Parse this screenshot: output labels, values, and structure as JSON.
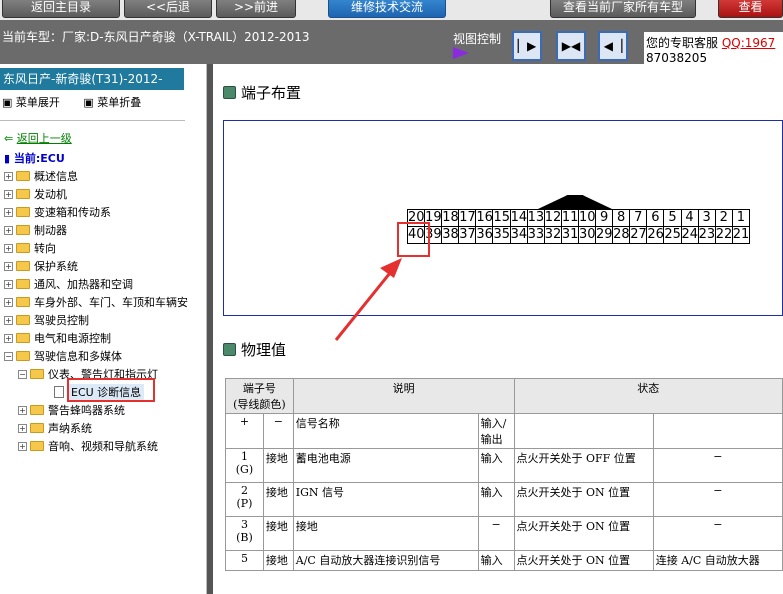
{
  "nav": {
    "home": "返回主目录",
    "back": "<<后退",
    "forward": ">>前进",
    "tech": "维修技术交流",
    "check": "查看当前厂家所有车型",
    "red": "查看"
  },
  "infobar": {
    "car_model": "当前车型：厂家:D-东风日产奇骏（X-TRAIL）2012-2013",
    "view_control": "视图控制",
    "cs_label": "您的专职客服",
    "qq": "QQ:1967",
    "qq_cont": "87038205"
  },
  "sidebar": {
    "title": "东风日产-新奇骏(T31)-2012-",
    "expand": "菜单展开",
    "collapse": "菜单折叠",
    "back_level": "返回上一级",
    "current": "当前:ECU",
    "items": [
      "概述信息",
      "发动机",
      "变速箱和传动系",
      "制动器",
      "转向",
      "保护系统",
      "通风、加热器和空调",
      "车身外部、车门、车顶和车辆安",
      "驾驶员控制",
      "电气和电源控制",
      "驾驶信息和多媒体",
      "仪表、警告灯和指示灯",
      "ECU 诊断信息",
      "警告蜂鸣器系统",
      "声纳系统",
      "音响、视频和导航系统"
    ]
  },
  "main": {
    "terminal_layout": "端子布置",
    "physical_values": "物理值",
    "top_pins": [
      "20",
      "19",
      "18",
      "17",
      "16",
      "15",
      "14",
      "13",
      "12",
      "11",
      "10",
      "9",
      "8",
      "7",
      "6",
      "5",
      "4",
      "3",
      "2",
      "1"
    ],
    "bottom_pins": [
      "40",
      "39",
      "38",
      "37",
      "36",
      "35",
      "34",
      "33",
      "32",
      "31",
      "30",
      "29",
      "28",
      "27",
      "26",
      "25",
      "24",
      "23",
      "22",
      "21"
    ],
    "table": {
      "h_terminal": "端子号",
      "h_wire": "(导线颜色)",
      "h_desc": "说明",
      "h_status": "状态",
      "h_plus": "+",
      "h_minus": "−",
      "h_signal": "信号名称",
      "h_io1": "输入/",
      "h_io2": "输出",
      "rows": [
        {
          "num": "1",
          "color": "(G)",
          "ground": "接地",
          "signal": "蓄电池电源",
          "io": "输入",
          "cond": "点火开关处于  OFF 位置",
          "state": "−"
        },
        {
          "num": "2",
          "color": "(P)",
          "ground": "接地",
          "signal": "IGN 信号",
          "io": "输入",
          "cond": "点火开关处于  ON 位置",
          "state": "−"
        },
        {
          "num": "3",
          "color": "(B)",
          "ground": "接地",
          "signal": "接地",
          "io": "−",
          "cond": "点火开关处于  ON 位置",
          "state": "−"
        },
        {
          "num": "5",
          "color": "",
          "ground": "接地",
          "signal": "A/C 自动放大器连接识别信号",
          "io": "输入",
          "cond": "点火开关处于  ON 位置",
          "state": "连接  A/C 自动放大器"
        }
      ]
    }
  }
}
